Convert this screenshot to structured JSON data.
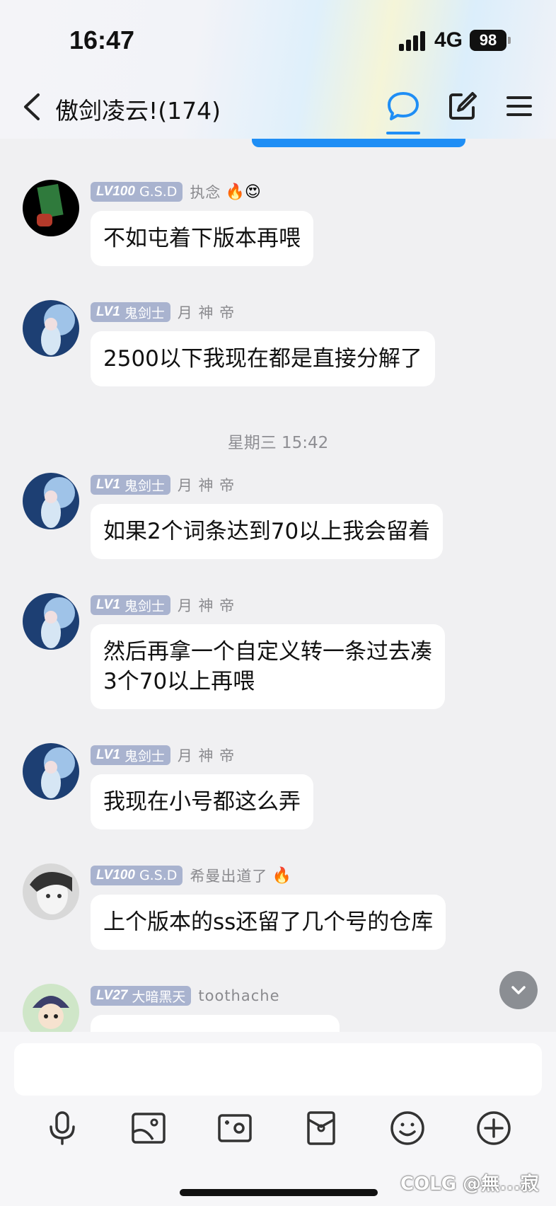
{
  "status_bar": {
    "time": "16:47",
    "network": "4G",
    "battery": "98"
  },
  "header": {
    "title": "傲剑凌云!(174)",
    "icons": [
      "back-chevron-icon",
      "chat-bubble-icon",
      "edit-icon",
      "menu-icon"
    ]
  },
  "colors": {
    "accent": "#1f8ef5",
    "badge": "#a9b3cf",
    "background": "#f0f0f2"
  },
  "messages": [
    {
      "level": "LV100",
      "title": "G.S.D",
      "nickname": "执念",
      "emoji": "🔥😍",
      "text": "不如屯着下版本再喂"
    },
    {
      "level": "LV1",
      "title": "鬼剑士",
      "nickname": "月 神 帝",
      "emoji": "",
      "text": "2500以下我现在都是直接分解了"
    },
    {
      "level": "LV1",
      "title": "鬼剑士",
      "nickname": "月 神 帝",
      "emoji": "",
      "text": "如果2个词条达到70以上我会留着"
    },
    {
      "level": "LV1",
      "title": "鬼剑士",
      "nickname": "月 神 帝",
      "emoji": "",
      "text_line1": "然后再拿一个自定义转一条过去凑",
      "text_line2": "3个70以上再喂"
    },
    {
      "level": "LV1",
      "title": "鬼剑士",
      "nickname": "月 神 帝",
      "emoji": "",
      "text": "我现在小号都这么弄"
    },
    {
      "level": "LV100",
      "title": "G.S.D",
      "nickname": "希曼出道了",
      "emoji": "🔥",
      "text": "上个版本的ss还留了几个号的仓库"
    },
    {
      "level": "LV27",
      "title": "大暗黑天",
      "nickname": "toothache",
      "emoji": "",
      "text": ""
    }
  ],
  "timestamp": "星期三 15:42",
  "input": {
    "value": ""
  },
  "toolbar": [
    "microphone-icon",
    "image-icon",
    "camera-icon",
    "red-packet-icon",
    "emoji-icon",
    "plus-icon"
  ],
  "watermark": "COLG @無...寂"
}
